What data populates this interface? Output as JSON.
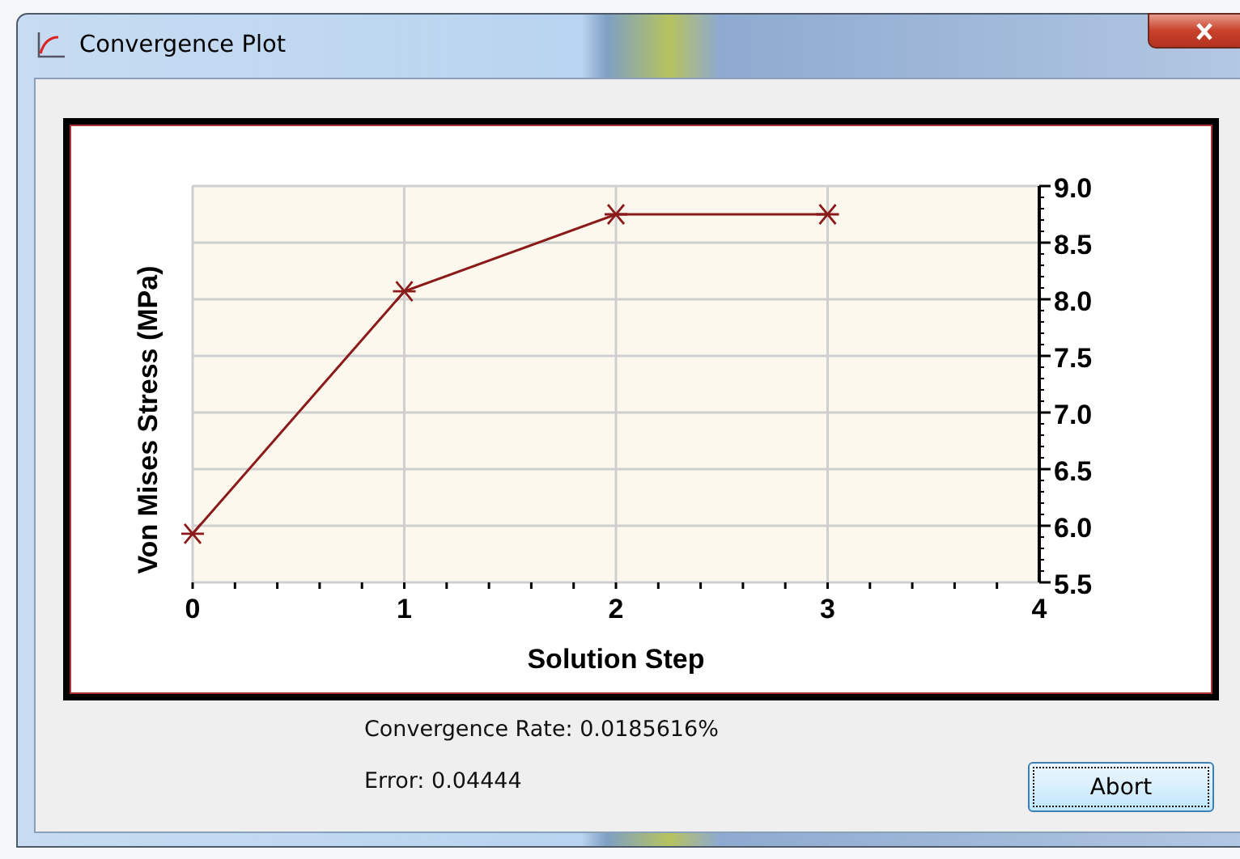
{
  "window": {
    "title": "Convergence Plot"
  },
  "plot": {
    "chart_data": {
      "type": "line",
      "xlabel": "Solution Step",
      "ylabel": "Von Mises Stress (MPa)",
      "x": [
        0,
        1,
        2,
        3
      ],
      "grid": true,
      "series": [
        {
          "color": "#8b1a1a",
          "marker": "cross",
          "values": [
            5.93,
            8.07,
            8.75,
            8.75
          ]
        }
      ],
      "xlim": [
        0,
        4
      ],
      "ylim": [
        5.5,
        9.0
      ],
      "xticks": [
        0,
        1,
        2,
        3,
        4
      ],
      "yticks": [
        {
          "value": 5.5,
          "label": "5.5"
        },
        {
          "value": 6.0,
          "label": "6.0"
        },
        {
          "value": 6.5,
          "label": "6.5"
        },
        {
          "value": 7.0,
          "label": "7.0"
        },
        {
          "value": 7.5,
          "label": "7.5"
        },
        {
          "value": 8.0,
          "label": "8.0"
        },
        {
          "value": 8.5,
          "label": "8.5"
        },
        {
          "value": 9.0,
          "label": "9.0"
        }
      ]
    }
  },
  "convergence_rate": "Convergence Rate: 0.0185616%",
  "error": "Error: 0.04444",
  "buttons": [
    {
      "label": "Abort"
    }
  ]
}
